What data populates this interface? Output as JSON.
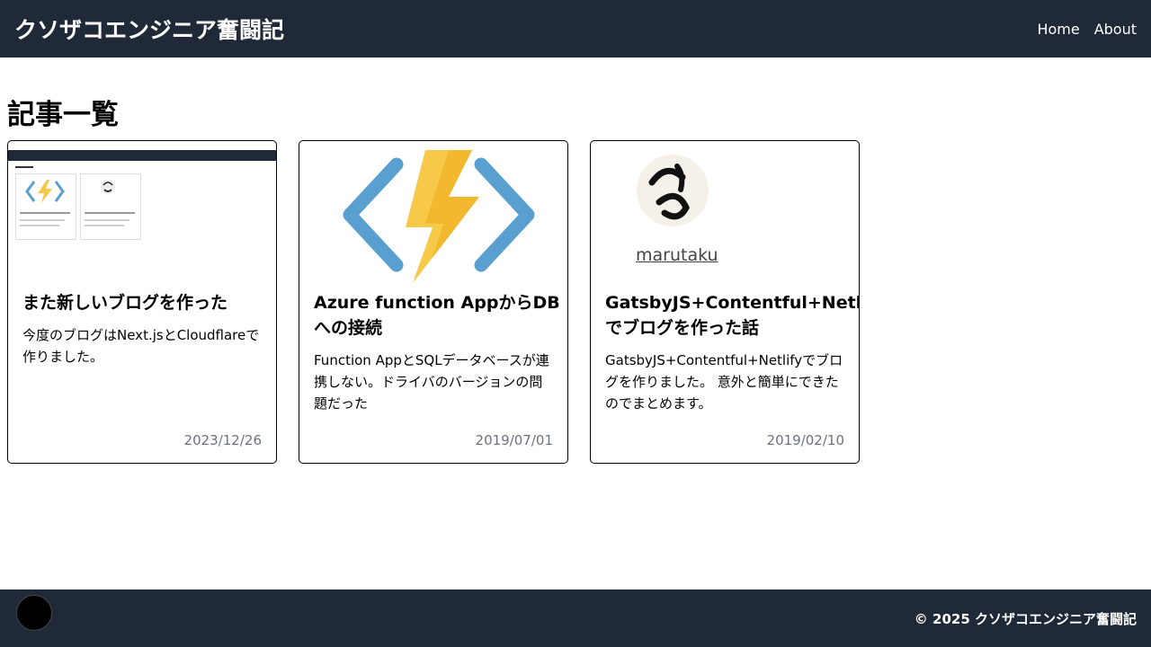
{
  "header": {
    "site_title": "クソザコエンジニア奮闘記",
    "nav": [
      {
        "label": "Home"
      },
      {
        "label": "About"
      }
    ]
  },
  "main": {
    "heading": "記事一覧",
    "cards": [
      {
        "title": "また新しいブログを作った",
        "description": "今度のブログはNext.jsとCloudflareで作りました。",
        "date": "2023/12/26",
        "thumbnail": "blog-screenshot"
      },
      {
        "title": "Azure function AppからDBへの接続",
        "description": "Function AppとSQLデータベースが連携しない。ドライバのバージョンの問題だった",
        "date": "2019/07/01",
        "thumbnail": "azure-functions-logo"
      },
      {
        "title": "GatsbyJS+Contentful+Netlifyでブログを作った話",
        "description": "GatsbyJS+Contentful+Netlifyでブログを作りました。 意外と簡単にできたのでまとめます。",
        "date": "2019/02/10",
        "thumbnail": "marutaku-avatar",
        "thumbnail_caption": "marutaku"
      }
    ]
  },
  "footer": {
    "copyright": "© 2025 クソザコエンジニア奮闘記"
  },
  "colors": {
    "header_bg": "#1f2937",
    "date_text": "#6b7280",
    "azure_blue": "#59a0d0",
    "bolt_yellow": "#f7c948"
  }
}
